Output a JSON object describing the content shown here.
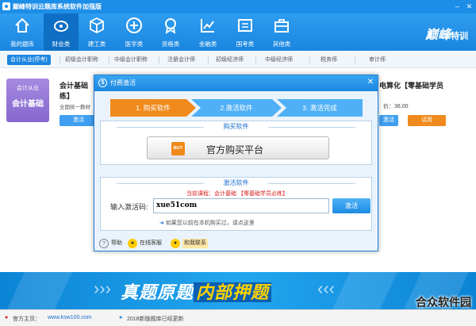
{
  "window": {
    "title": "巅峰特训云题库系统软件加强版",
    "minimize": "–",
    "close": "✕"
  },
  "nav": {
    "items": [
      {
        "label": "我的题库",
        "icon": "home-icon"
      },
      {
        "label": "财会类",
        "icon": "piggybank-icon"
      },
      {
        "label": "建工类",
        "icon": "cube-icon"
      },
      {
        "label": "医学类",
        "icon": "medical-cross-icon"
      },
      {
        "label": "资格类",
        "icon": "certificate-icon"
      },
      {
        "label": "金融类",
        "icon": "chart-icon"
      },
      {
        "label": "国考类",
        "icon": "flag-icon"
      },
      {
        "label": "其他类",
        "icon": "briefcase-icon"
      }
    ],
    "brand_a": "巅峰",
    "brand_b": "特训"
  },
  "categories": [
    "会计从业(停考)",
    "初级会计职称",
    "中级会计职称",
    "注册会计师",
    "初级经济师",
    "中级经济师",
    "税务师",
    "审计师"
  ],
  "course": {
    "thumb_line1": "会计从业",
    "thumb_line2": "会计基础",
    "title_line1": "会计基础",
    "title_line2": "练】",
    "subtitle": "全国统一教材",
    "right_title": "电算化【零基础学员",
    "price": "价：38.00",
    "btn_activate": "激活",
    "btn_trial": "试用"
  },
  "dialog": {
    "title": "付费激活",
    "icon": "dollar-icon",
    "steps": [
      "1. 购买软件",
      "2.激活软件",
      "3. 激活完成"
    ],
    "buy_section_title": "购买软件",
    "buy_icon_text": "BUY",
    "buy_button": "官方购买平台",
    "activate_section_title": "激活软件",
    "current_course": "当前课程：会计基础 【零基础学员必练】",
    "code_label": "输入激活码:",
    "code_value": "xue51com",
    "activate_button": "激活",
    "hint": "如果您以前在本机购买过，请点这里",
    "footer": {
      "help": "帮助",
      "online": "在线客服",
      "contact": "和我联系"
    }
  },
  "banner": {
    "slogan_a": "真题原题",
    "slogan_b": "内部押题"
  },
  "status": {
    "home_label": "官方主页：",
    "home_url": "www.ksw100.com",
    "news": "2018新版题库已经更新"
  },
  "watermark": "合众软件园",
  "colors": {
    "primary": "#1b86e0",
    "step_active": "#f08a1c",
    "step_inactive": "#4fb0f5",
    "trial": "#f08a1c"
  }
}
